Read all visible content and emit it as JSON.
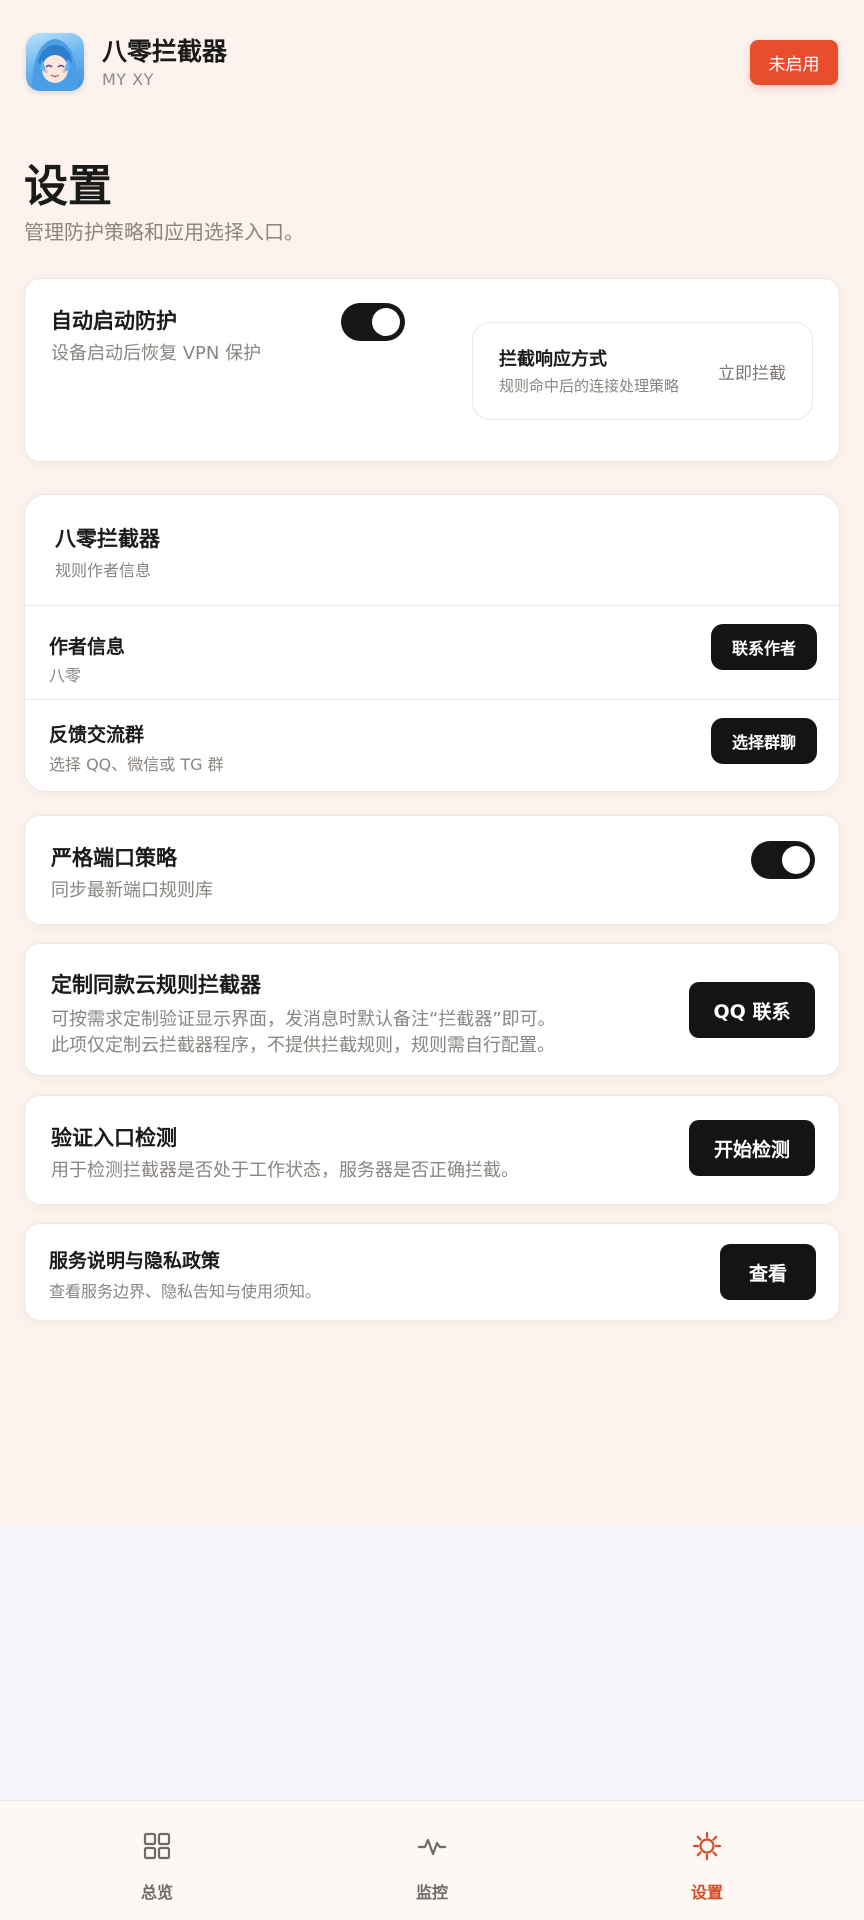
{
  "header": {
    "app_name": "八零拦截器",
    "app_sub": "MY XY",
    "status_label": "未启用"
  },
  "page": {
    "title": "设置",
    "subtitle": "管理防护策略和应用选择入口。"
  },
  "auto_protect": {
    "title": "自动启动防护",
    "desc": "设备启动后恢复 VPN 保护",
    "enabled": true,
    "response": {
      "title": "拦截响应方式",
      "desc": "规则命中后的连接处理策略",
      "value": "立即拦截"
    }
  },
  "author_card": {
    "title": "八零拦截器",
    "subtitle": "规则作者信息",
    "rows": [
      {
        "title": "作者信息",
        "desc": "八零",
        "button": "联系作者"
      },
      {
        "title": "反馈交流群",
        "desc": "选择 QQ、微信或 TG 群",
        "button": "选择群聊"
      }
    ]
  },
  "strict_port": {
    "title": "严格端口策略",
    "desc": "同步最新端口规则库",
    "enabled": true
  },
  "custom_rules": {
    "title": "定制同款云规则拦截器",
    "desc_line1": "可按需求定制验证显示界面，发消息时默认备注“拦截器”即可。",
    "desc_line2": "此项仅定制云拦截器程序，不提供拦截规则，规则需自行配置。",
    "button": "QQ 联系"
  },
  "verify_entry": {
    "title": "验证入口检测",
    "desc": "用于检测拦截器是否处于工作状态，服务器是否正确拦截。",
    "button": "开始检测"
  },
  "privacy": {
    "title": "服务说明与隐私政策",
    "desc": "查看服务边界、隐私告知与使用须知。",
    "button": "查看"
  },
  "nav": {
    "items": [
      {
        "label": "总览",
        "icon": "grid-icon",
        "active": false
      },
      {
        "label": "监控",
        "icon": "pulse-icon",
        "active": false
      },
      {
        "label": "设置",
        "icon": "gear-icon",
        "active": true
      }
    ],
    "active_color": "#d64a25",
    "inactive_color": "#6f6a66"
  },
  "colors": {
    "accent": "#e84e2e",
    "dark_button": "#141414",
    "page_bg": "#fcf3ee"
  }
}
